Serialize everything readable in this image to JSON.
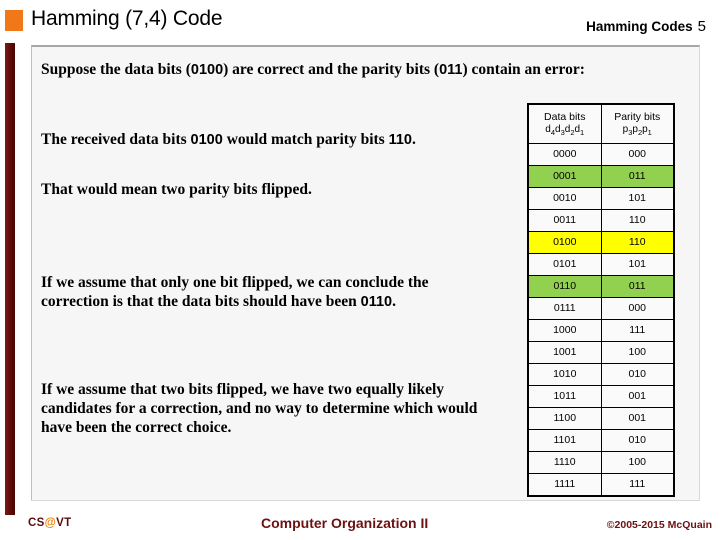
{
  "header": {
    "title": "Hamming (7,4) Code",
    "subject": "Hamming Codes",
    "slide_number": "5",
    "bullet_color": "#F07818"
  },
  "content": {
    "intro_before": "Suppose the data bits (",
    "intro_bits_data": "0100",
    "intro_middle": ") are correct and the parity bits (",
    "intro_bits_parity": "011",
    "intro_after": ") contain an error:",
    "para1_before": "The received data bits ",
    "para1_bits_data": "0100",
    "para1_middle": " would match parity bits ",
    "para1_bits_parity": "110",
    "para1_after": ".",
    "para2": "That would mean two parity bits flipped.",
    "para3_before": "If we assume that only one bit flipped, we can conclude the correction is that the data bits should have been ",
    "para3_bits": "0110",
    "para3_after": ".",
    "para4": "If we assume that two bits flipped, we have two equally likely candidates for a correction, and no way to determine which would have been the correct choice."
  },
  "table": {
    "headers": {
      "data_main": "Data bits",
      "data_sub_parts": [
        "d",
        "4",
        "d",
        "3",
        "d",
        "2",
        "d",
        "1"
      ],
      "parity_main": "Parity bits",
      "parity_sub_parts": [
        "p",
        "3",
        "p",
        "2",
        "p",
        "1"
      ]
    },
    "highlight_green": "#92D050",
    "highlight_yellow": "#FFFF00",
    "rows": [
      {
        "data": "0000",
        "parity": "000",
        "highlight": "none"
      },
      {
        "data": "0001",
        "parity": "011",
        "highlight": "green"
      },
      {
        "data": "0010",
        "parity": "101",
        "highlight": "none"
      },
      {
        "data": "0011",
        "parity": "110",
        "highlight": "none"
      },
      {
        "data": "0100",
        "parity": "110",
        "highlight": "yellow"
      },
      {
        "data": "0101",
        "parity": "101",
        "highlight": "none"
      },
      {
        "data": "0110",
        "parity": "011",
        "highlight": "green"
      },
      {
        "data": "0111",
        "parity": "000",
        "highlight": "none"
      },
      {
        "data": "1000",
        "parity": "111",
        "highlight": "none"
      },
      {
        "data": "1001",
        "parity": "100",
        "highlight": "none"
      },
      {
        "data": "1010",
        "parity": "010",
        "highlight": "none"
      },
      {
        "data": "1011",
        "parity": "001",
        "highlight": "none"
      },
      {
        "data": "1100",
        "parity": "001",
        "highlight": "none"
      },
      {
        "data": "1101",
        "parity": "010",
        "highlight": "none"
      },
      {
        "data": "1110",
        "parity": "100",
        "highlight": "none"
      },
      {
        "data": "1111",
        "parity": "111",
        "highlight": "none"
      }
    ]
  },
  "footer": {
    "logo_pre": "CS",
    "logo_at": "@",
    "logo_post": "VT",
    "course": "Computer Organization II",
    "copyright": "©2005-2015 McQuain"
  }
}
